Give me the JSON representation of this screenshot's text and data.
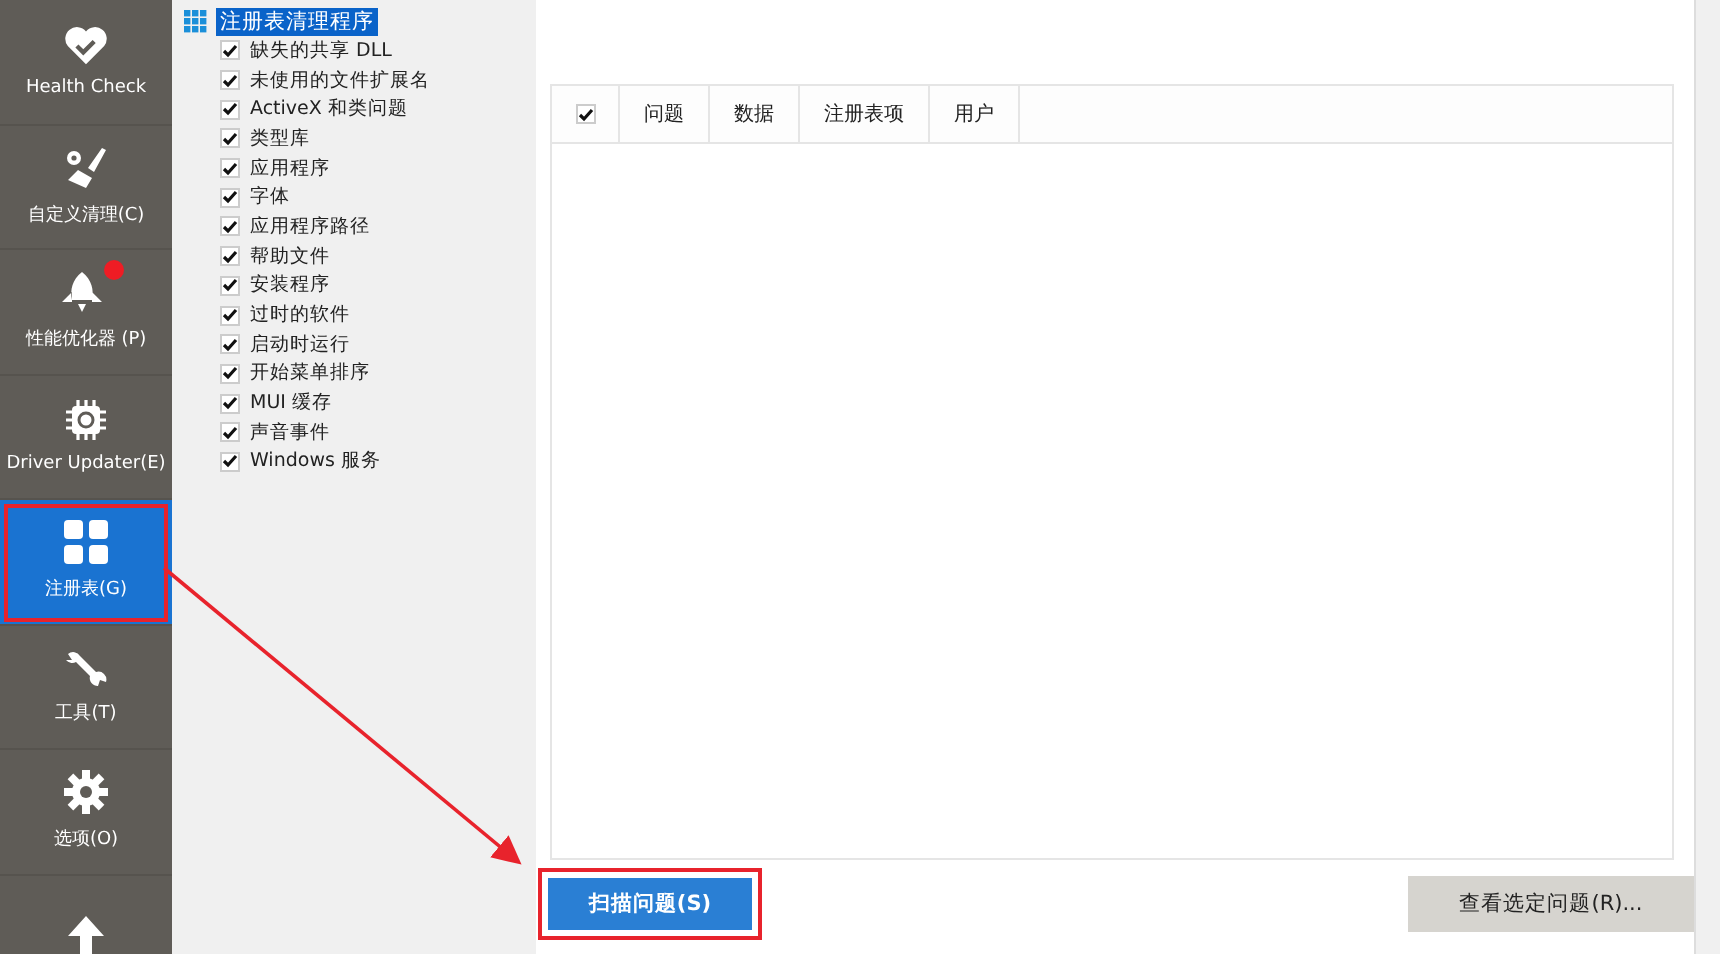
{
  "sidebar": {
    "items": [
      {
        "label": "Health Check",
        "selected": false,
        "highlighted": false,
        "badge": false
      },
      {
        "label": "自定义清理(C)",
        "selected": false,
        "highlighted": false,
        "badge": false
      },
      {
        "label": "性能优化器 (P)",
        "selected": false,
        "highlighted": false,
        "badge": true
      },
      {
        "label": "Driver Updater(E)",
        "selected": false,
        "highlighted": false,
        "badge": false
      },
      {
        "label": "注册表(G)",
        "selected": true,
        "highlighted": true,
        "badge": false
      },
      {
        "label": "工具(T)",
        "selected": false,
        "highlighted": false,
        "badge": false
      },
      {
        "label": "选项(O)",
        "selected": false,
        "highlighted": false,
        "badge": false
      },
      {
        "selected": false,
        "highlighted": false,
        "badge": false
      }
    ]
  },
  "tree": {
    "root": {
      "label": "注册表清理程序",
      "selected": true
    },
    "children": [
      {
        "label": "缺失的共享 DLL",
        "checked": true
      },
      {
        "label": "未使用的文件扩展名",
        "checked": true
      },
      {
        "label": "ActiveX 和类问题",
        "checked": true
      },
      {
        "label": "类型库",
        "checked": true
      },
      {
        "label": "应用程序",
        "checked": true
      },
      {
        "label": "字体",
        "checked": true
      },
      {
        "label": "应用程序路径",
        "checked": true
      },
      {
        "label": "帮助文件",
        "checked": true
      },
      {
        "label": "安装程序",
        "checked": true
      },
      {
        "label": "过时的软件",
        "checked": true
      },
      {
        "label": "启动时运行",
        "checked": true
      },
      {
        "label": "开始菜单排序",
        "checked": true
      },
      {
        "label": "MUI 缓存",
        "checked": true
      },
      {
        "label": "声音事件",
        "checked": true
      },
      {
        "label": "Windows 服务",
        "checked": true
      }
    ]
  },
  "table": {
    "select_all": {
      "checked": true
    },
    "columns": [
      "问题",
      "数据",
      "注册表项",
      "用户"
    ]
  },
  "buttons": [
    {
      "label": "扫描问题(S)",
      "kind": "primary",
      "highlighted": true
    },
    {
      "label": "查看选定问题(R)...",
      "kind": "secondary",
      "highlighted": false
    }
  ],
  "annotation": {
    "arrow": true
  }
}
